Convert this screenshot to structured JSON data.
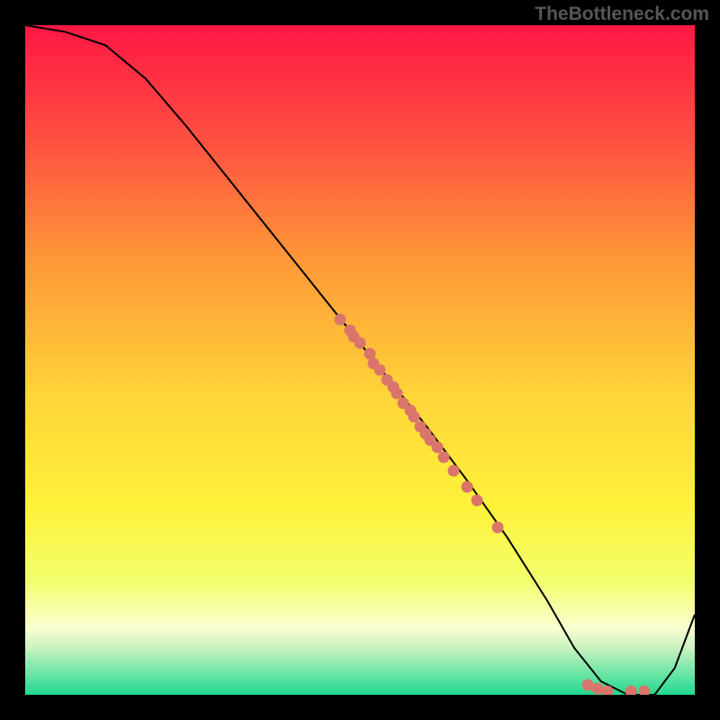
{
  "watermark": "TheBottleneck.com",
  "colors": {
    "top": "#ff1744",
    "upper": "#ff5340",
    "mid_upper": "#ff9838",
    "mid": "#ffd438",
    "mid_lower": "#fff23a",
    "lower": "#f1ff6c",
    "pale": "#faffd0",
    "green_pale": "#c8f2c0",
    "green_mid": "#7fe8ab",
    "green": "#1fd98f",
    "curve": "#000000",
    "dot": "#d9756b",
    "bg": "#000000"
  },
  "chart_data": {
    "type": "line",
    "title": "",
    "xlabel": "",
    "ylabel": "",
    "xlim": [
      0,
      100
    ],
    "ylim": [
      0,
      100
    ],
    "curve": {
      "x": [
        0,
        6,
        12,
        18,
        24,
        30,
        36,
        42,
        48,
        54,
        60,
        66,
        72,
        78,
        82,
        86,
        90,
        94,
        97,
        100
      ],
      "y": [
        100,
        99,
        97,
        92,
        85,
        77.5,
        70,
        62.5,
        55,
        47.5,
        40,
        32,
        23.5,
        14,
        7,
        2,
        0,
        0,
        4,
        12
      ]
    },
    "series": [
      {
        "name": "scatter-cluster-upper",
        "type": "scatter",
        "x": [
          47,
          48.5,
          49,
          50,
          51.5,
          52,
          53,
          54,
          55,
          55.5,
          56.5,
          57.5,
          58,
          59,
          59.8,
          60.5,
          61.5,
          62.5,
          64,
          66,
          67.5,
          70.5
        ],
        "y": [
          56,
          54.5,
          53.5,
          52.5,
          51,
          49.5,
          48.5,
          47,
          46,
          45,
          43.5,
          42.5,
          41.5,
          40,
          39,
          38,
          37,
          35.5,
          33.5,
          31,
          29,
          25
        ]
      },
      {
        "name": "scatter-cluster-bottom",
        "type": "scatter",
        "x": [
          84,
          85.5,
          87,
          90.5,
          92.5
        ],
        "y": [
          1.5,
          1,
          0.5,
          0.5,
          0.5
        ]
      }
    ]
  }
}
